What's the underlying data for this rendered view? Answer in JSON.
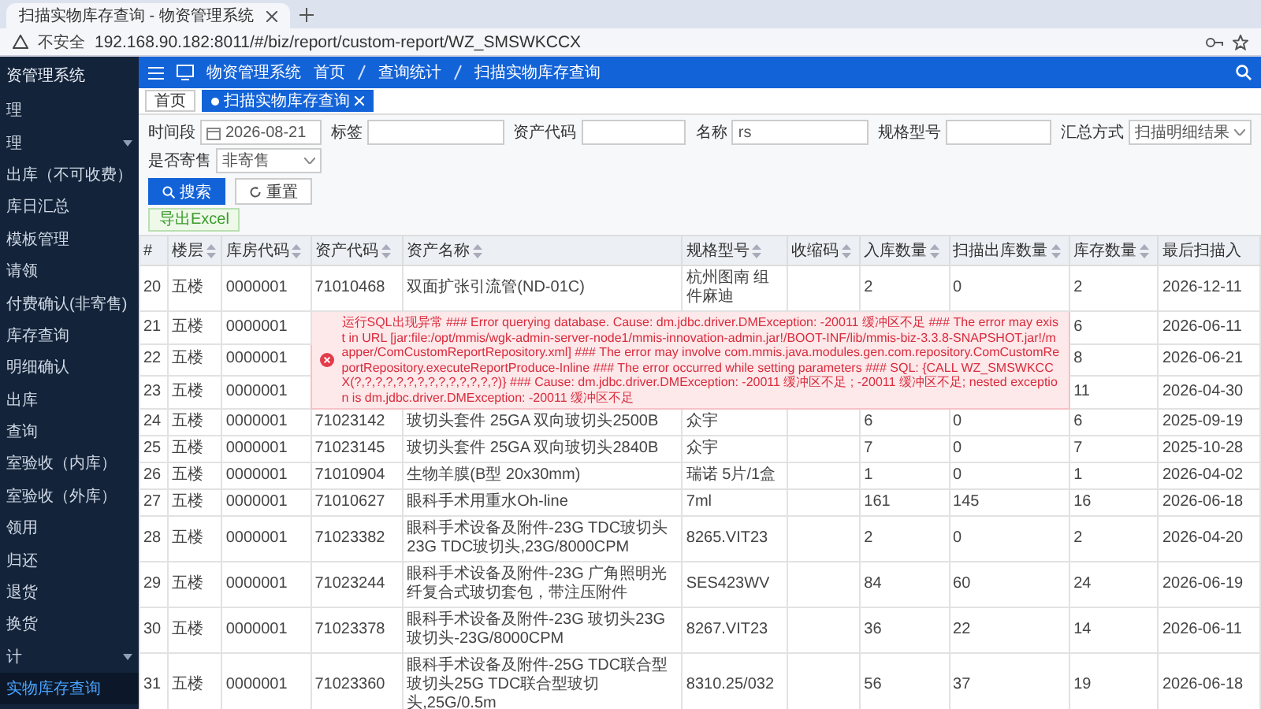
{
  "browser": {
    "tab_title": "扫描实物库存查询 - 物资管理系统",
    "security_label": "不安全",
    "url": "192.168.90.182:8011/#/biz/report/custom-report/WZ_SMSWKCCX"
  },
  "sidebar": {
    "title": "资管理系统",
    "items": [
      {
        "label": "理",
        "kind": "page",
        "selected": false
      },
      {
        "label": "理",
        "kind": "group",
        "selected": false
      },
      {
        "label": "出库（不可收费）",
        "kind": "page",
        "selected": false
      },
      {
        "label": "库日汇总",
        "kind": "page",
        "selected": false
      },
      {
        "label": "模板管理",
        "kind": "page",
        "selected": false
      },
      {
        "label": "请领",
        "kind": "page",
        "selected": false
      },
      {
        "label": "付费确认(非寄售)",
        "kind": "page",
        "selected": false
      },
      {
        "label": "库存查询",
        "kind": "page",
        "selected": false
      },
      {
        "label": "明细确认",
        "kind": "page",
        "selected": false
      },
      {
        "label": "出库",
        "kind": "page",
        "selected": false
      },
      {
        "label": "查询",
        "kind": "page",
        "selected": false
      },
      {
        "label": "室验收（内库）",
        "kind": "page",
        "selected": false
      },
      {
        "label": "室验收（外库）",
        "kind": "page",
        "selected": false
      },
      {
        "label": "领用",
        "kind": "page",
        "selected": false
      },
      {
        "label": "归还",
        "kind": "page",
        "selected": false
      },
      {
        "label": "退货",
        "kind": "page",
        "selected": false
      },
      {
        "label": "换货",
        "kind": "page",
        "selected": false
      },
      {
        "label": "计",
        "kind": "group",
        "selected": false
      },
      {
        "label": "实物库存查询",
        "kind": "page",
        "selected": true
      }
    ]
  },
  "header": {
    "app_name": "物资管理系统",
    "breadcrumb": [
      "首页",
      "查询统计",
      "扫描实物库存查询"
    ]
  },
  "tags": [
    {
      "label": "首页",
      "selected": false,
      "closable": false
    },
    {
      "label": "扫描实物库存查询",
      "selected": true,
      "closable": true
    }
  ],
  "filters": [
    {
      "kind": "date",
      "label": "时间段",
      "value": "2026-08-21"
    },
    {
      "kind": "text",
      "label": "标签"
    },
    {
      "kind": "text",
      "label": "资产代码"
    },
    {
      "kind": "text",
      "label": "名称",
      "value": "rs"
    },
    {
      "kind": "text",
      "label": "规格型号"
    },
    {
      "kind": "select",
      "label": "汇总方式",
      "value": "扫描明细结果"
    },
    {
      "kind": "select",
      "label": "是否寄售",
      "value": "非寄售"
    }
  ],
  "buttons": [
    {
      "kind": "primary",
      "label": "搜索"
    },
    {
      "kind": "plain",
      "label": "重置"
    }
  ],
  "export_button": "导出Excel",
  "table": {
    "columns": [
      {
        "label": "#",
        "sortable": false
      },
      {
        "label": "楼层",
        "sortable": true
      },
      {
        "label": "库房代码",
        "sortable": true
      },
      {
        "label": "资产代码",
        "sortable": true
      },
      {
        "label": "资产名称",
        "sortable": true
      },
      {
        "label": "规格型号",
        "sortable": true
      },
      {
        "label": "收缩码",
        "sortable": true
      },
      {
        "label": "入库数量",
        "sortable": true
      },
      {
        "label": "扫描出库数量",
        "sortable": true
      },
      {
        "label": "库存数量",
        "sortable": true
      },
      {
        "label": "最后扫描入",
        "sortable": false
      }
    ],
    "rows": [
      [
        "20",
        "五楼",
        "0000001",
        "71010468",
        "双面扩张引流管(ND-01C)",
        "杭州图南 组件麻迪",
        null,
        "2",
        "0",
        "2",
        "2026-12-11"
      ],
      [
        "21",
        "五楼",
        "0000001",
        null,
        null,
        null,
        null,
        null,
        null,
        "6",
        "2026-06-11"
      ],
      [
        "22",
        "五楼",
        "0000001",
        null,
        null,
        null,
        null,
        null,
        null,
        "8",
        "2026-06-21"
      ],
      [
        "23",
        "五楼",
        "0000001",
        null,
        null,
        null,
        null,
        null,
        null,
        "11",
        "2026-04-30"
      ],
      [
        "24",
        "五楼",
        "0000001",
        "71023142",
        "玻切头套件 25GA 双向玻切头2500B",
        "众宇",
        null,
        "6",
        "0",
        "6",
        "2025-09-19"
      ],
      [
        "25",
        "五楼",
        "0000001",
        "71023145",
        "玻切头套件 25GA 双向玻切头2840B",
        "众宇",
        null,
        "7",
        "0",
        "7",
        "2025-10-28"
      ],
      [
        "26",
        "五楼",
        "0000001",
        "71010904",
        "生物羊膜(B型 20x30mm)",
        "瑞诺 5片/1盒",
        null,
        "1",
        "0",
        "1",
        "2026-04-02"
      ],
      [
        "27",
        "五楼",
        "0000001",
        "71010627",
        "眼科手术用重水Oh-line",
        "7ml",
        null,
        "161",
        "145",
        "16",
        "2026-06-18"
      ],
      [
        "28",
        "五楼",
        "0000001",
        "71023382",
        "眼科手术设备及附件-23G TDC玻切头23G TDC玻切头,23G/8000CPM",
        "8265.VIT23",
        null,
        "2",
        "0",
        "2",
        "2026-04-20"
      ],
      [
        "29",
        "五楼",
        "0000001",
        "71023244",
        "眼科手术设备及附件-23G 广角照明光纤复合式玻切套包，带注压附件",
        "SES423WV",
        null,
        "84",
        "60",
        "24",
        "2026-06-19"
      ],
      [
        "30",
        "五楼",
        "0000001",
        "71023378",
        "眼科手术设备及附件-23G 玻切头23G玻切头-23G/8000CPM",
        "8267.VIT23",
        null,
        "36",
        "22",
        "14",
        "2026-06-11"
      ],
      [
        "31",
        "五楼",
        "0000001",
        "71023360",
        "眼科手术设备及附件-25G TDC联合型玻切头25G TDC联合型玻切头,25G/0.5m",
        "8310.25/032",
        null,
        "56",
        "37",
        "19",
        "2026-06-18"
      ]
    ]
  },
  "error_toast": {
    "message": "运行SQL出现异常 ### Error querying database. Cause: dm.jdbc.driver.DMException: -20011 缓冲区不足 ### The error may exist in URL [jar:file:/opt/mmis/wgk-admin-server-node1/mmis-innovation-admin.jar!/BOOT-INF/lib/mmis-biz-3.3.8-SNAPSHOT.jar!/mapper/ComCustomReportRepository.xml] ### The error may involve com.mmis.java.modules.gen.com.repository.ComCustomReportRepository.executeReportProduce-Inline ### The error occurred while setting parameters ### SQL: {CALL WZ_SMSWKCCX(?,?,?,?,?,?,?,?,?,?,?,?,?,?)} ### Cause: dm.jdbc.driver.DMException: -20011 缓冲区不足 ; -20011 缓冲区不足; nested exception is dm.jdbc.driver.DMException: -20011 缓冲区不足"
  }
}
